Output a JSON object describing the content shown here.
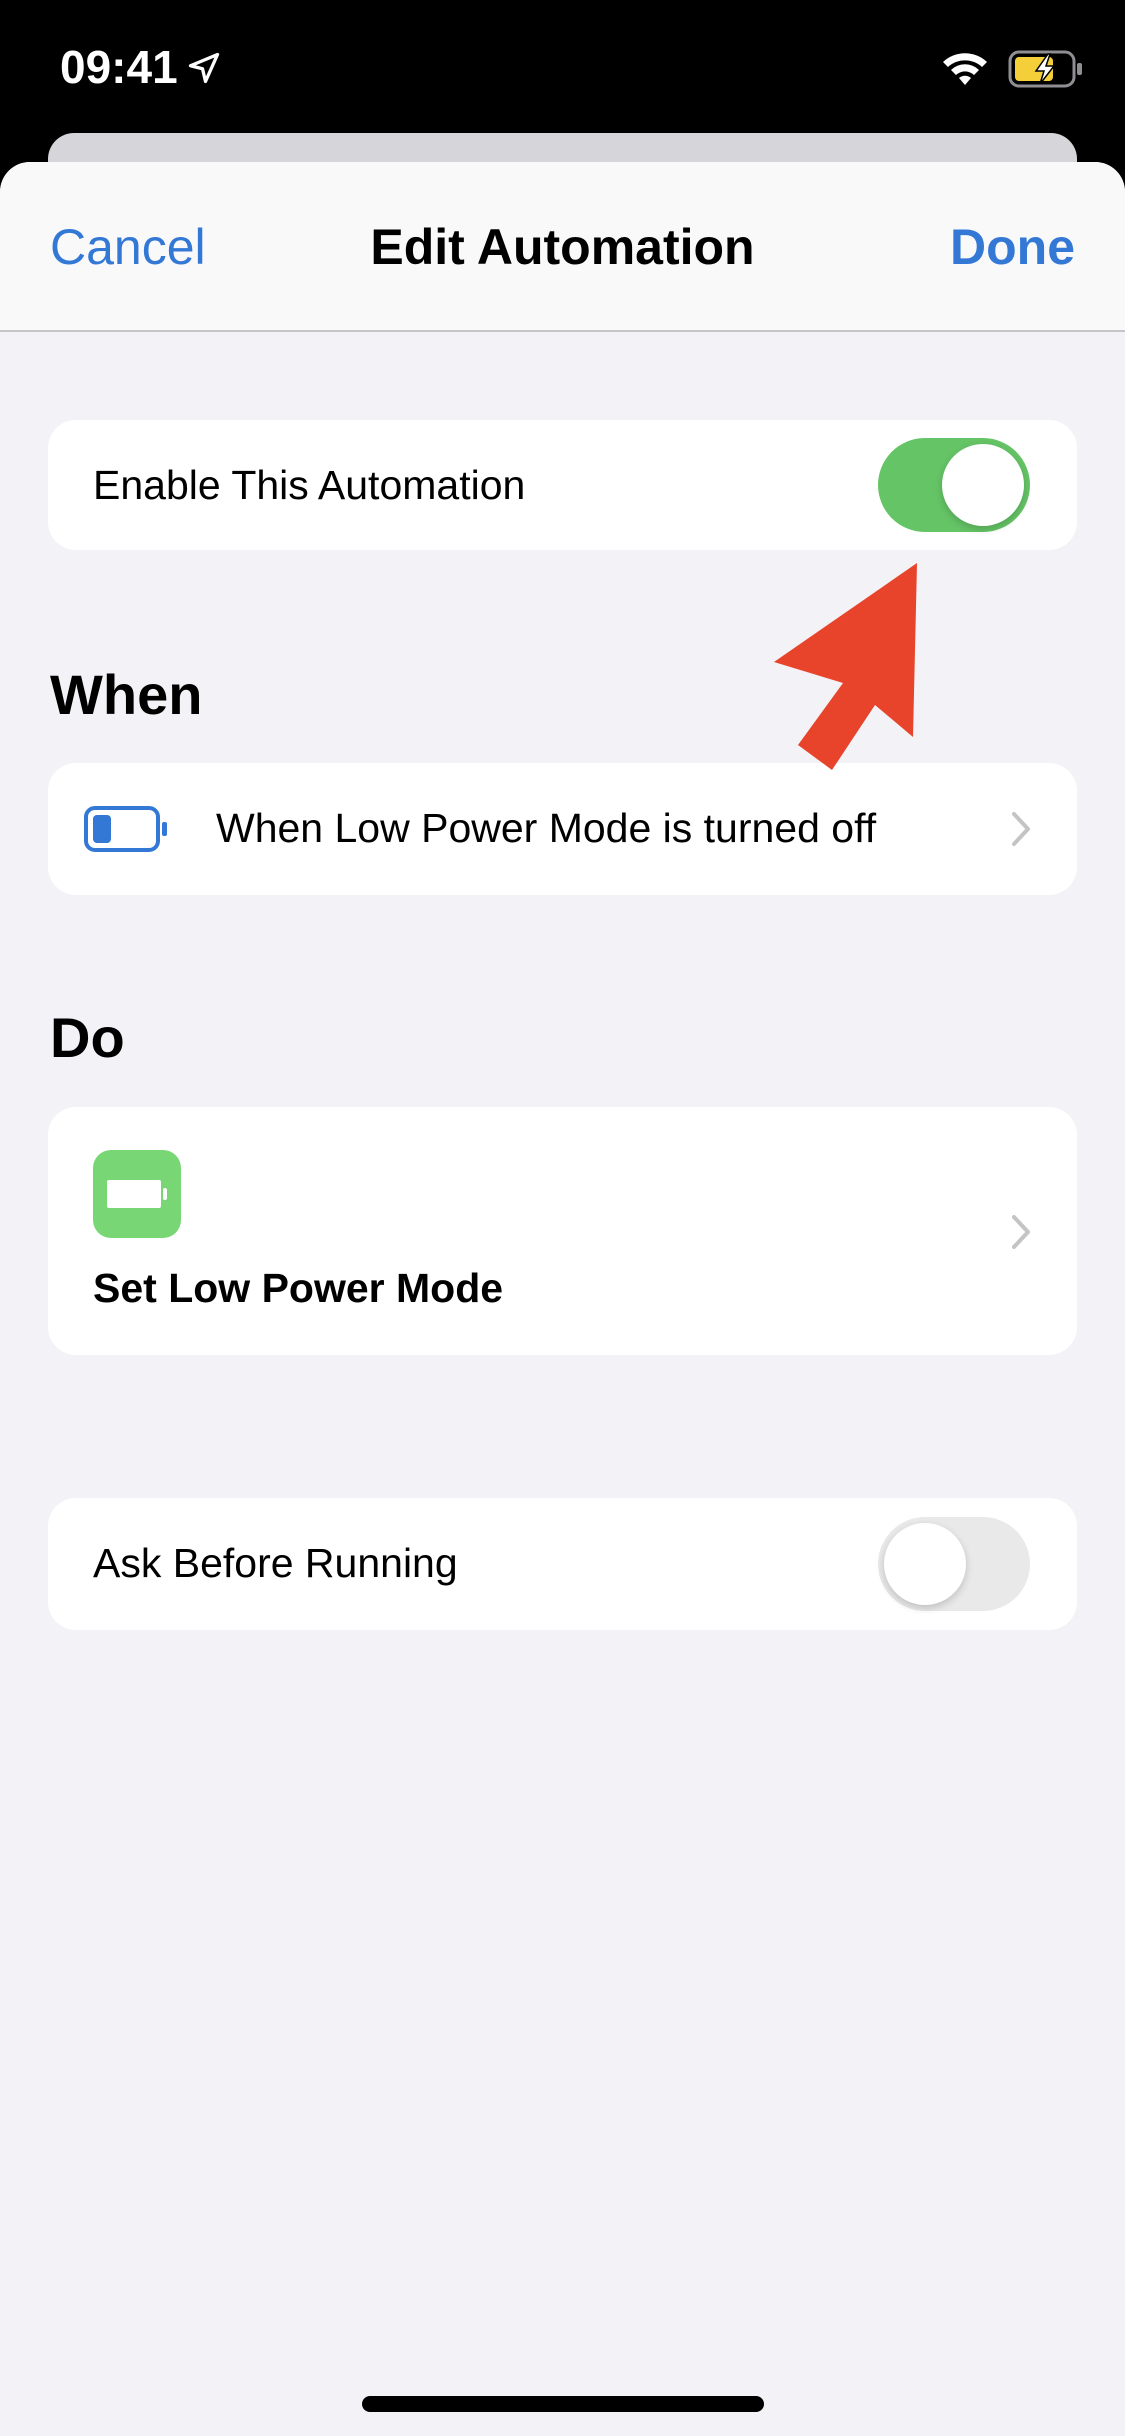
{
  "status_bar": {
    "time": "09:41",
    "location_icon": "location-arrow-icon",
    "wifi_icon": "wifi-icon",
    "battery_icon": "battery-charging-icon",
    "battery_color": "#f4cf3a"
  },
  "nav": {
    "cancel_label": "Cancel",
    "title": "Edit Automation",
    "done_label": "Done",
    "accent_color": "#3478d6"
  },
  "enable_row": {
    "label": "Enable This Automation",
    "toggle_on": true,
    "toggle_color": "#65c466"
  },
  "when_section": {
    "header": "When",
    "trigger": {
      "icon": "battery-low-icon",
      "label": "When Low Power Mode is turned off"
    }
  },
  "do_section": {
    "header": "Do",
    "action": {
      "icon": "battery-full-icon",
      "icon_bg": "#78d674",
      "label": "Set Low Power Mode"
    }
  },
  "ask_row": {
    "label": "Ask Before Running",
    "toggle_on": false
  },
  "annotation": {
    "arrow_color": "#e8442b"
  }
}
